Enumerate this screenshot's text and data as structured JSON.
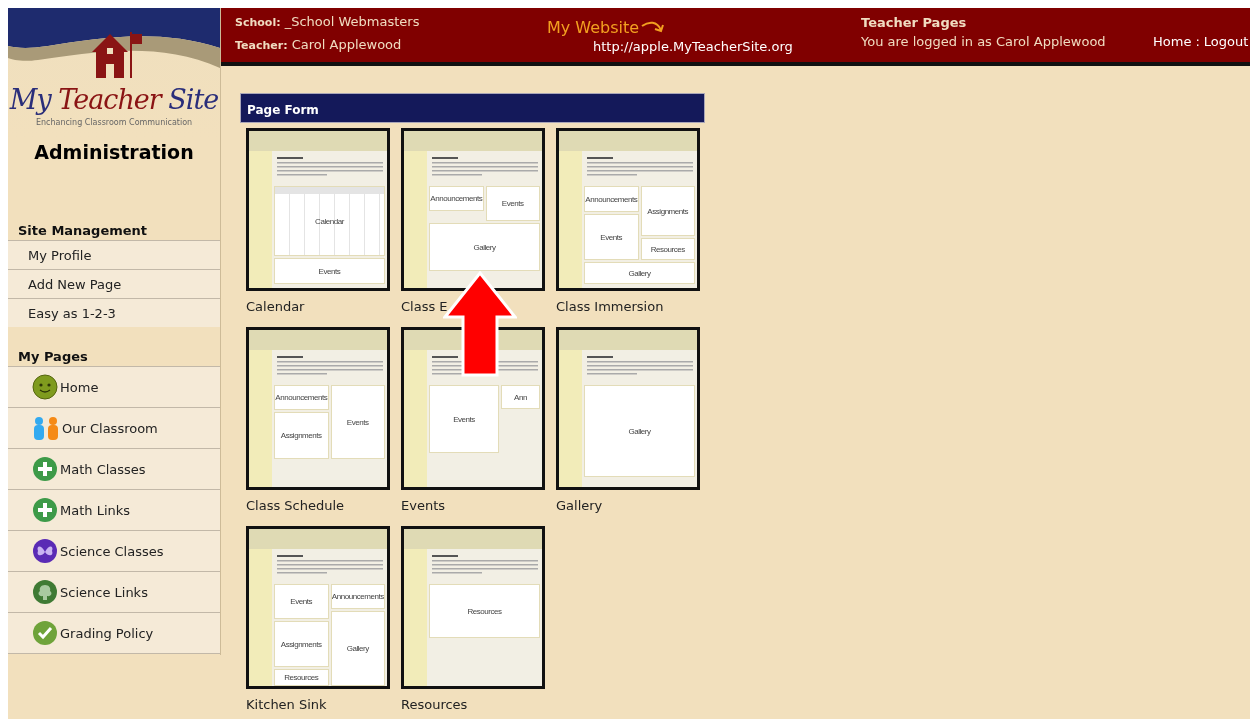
{
  "sidebar": {
    "logo": {
      "words": [
        "My",
        "Teacher",
        "Site"
      ],
      "tagline": "Enchancing Classroom Communication"
    },
    "heading": "Administration",
    "sections": [
      {
        "title": "Site Management",
        "items": [
          {
            "label": "My Profile"
          },
          {
            "label": "Add New Page"
          },
          {
            "label": "Easy as 1-2-3"
          }
        ]
      },
      {
        "title": "My Pages",
        "items": [
          {
            "label": "Home",
            "kind": "smiley"
          },
          {
            "label": "Our Classroom",
            "kind": "people"
          },
          {
            "label": "Math Classes",
            "kind": "plus"
          },
          {
            "label": "Math Links",
            "kind": "plus"
          },
          {
            "label": "Science Classes",
            "kind": "butterfly"
          },
          {
            "label": "Science Links",
            "kind": "tree"
          },
          {
            "label": "Grading Policy",
            "kind": "check"
          }
        ]
      }
    ]
  },
  "header": {
    "school": "**School:** _School Webmasters",
    "teacher": "**Teacher:** Carol Applewood",
    "website_label": "My Website",
    "website_url": "http://apple.MyTeacherSite.org",
    "section_title": "Teacher Pages",
    "login_status": "You are logged in as Carol Applewood",
    "nav_links": [
      "Home",
      "Logout"
    ],
    "nav_separator": ":"
  },
  "page_form": {
    "title": "Page Form",
    "templates": [
      {
        "name": "Calendar",
        "kind": "calendar",
        "blocks": [
          {
            "label": "Calendar",
            "kind": "calendar"
          },
          {
            "label": "Events",
            "kind": "box"
          }
        ]
      },
      {
        "name": "Class E",
        "kind": "class_events",
        "blocks": [
          {
            "label": "Announcements",
            "kind": "box"
          },
          {
            "label": "Events",
            "kind": "box"
          },
          {
            "label": "Gallery",
            "kind": "box"
          }
        ]
      },
      {
        "name": "Class Immersion",
        "kind": "immersion",
        "blocks": [
          {
            "label": "Announcements",
            "kind": "box"
          },
          {
            "label": "Assignments",
            "kind": "box"
          },
          {
            "label": "Events",
            "kind": "box"
          },
          {
            "label": "Resources",
            "kind": "box"
          },
          {
            "label": "Gallery",
            "kind": "box"
          }
        ]
      },
      {
        "name": "Class Schedule",
        "kind": "schedule",
        "blocks": [
          {
            "label": "Announcements",
            "kind": "box"
          },
          {
            "label": "Events",
            "kind": "box"
          },
          {
            "label": "Assignments",
            "kind": "box"
          }
        ]
      },
      {
        "name": "Events",
        "kind": "events",
        "blocks": [
          {
            "label": "Events",
            "kind": "box"
          },
          {
            "label": "Ann",
            "kind": "box"
          }
        ]
      },
      {
        "name": "Gallery",
        "kind": "gallery",
        "blocks": [
          {
            "label": "Gallery",
            "kind": "box"
          }
        ]
      },
      {
        "name": "Kitchen Sink",
        "kind": "sink",
        "blocks": [
          {
            "label": "Events",
            "kind": "box"
          },
          {
            "label": "Announcements",
            "kind": "box"
          },
          {
            "label": "Assignments",
            "kind": "box"
          },
          {
            "label": "Gallery",
            "kind": "box"
          },
          {
            "label": "Resources",
            "kind": "box"
          }
        ]
      },
      {
        "name": "Resources",
        "kind": "resources",
        "blocks": [
          {
            "label": "Resources",
            "kind": "box"
          }
        ]
      }
    ]
  }
}
